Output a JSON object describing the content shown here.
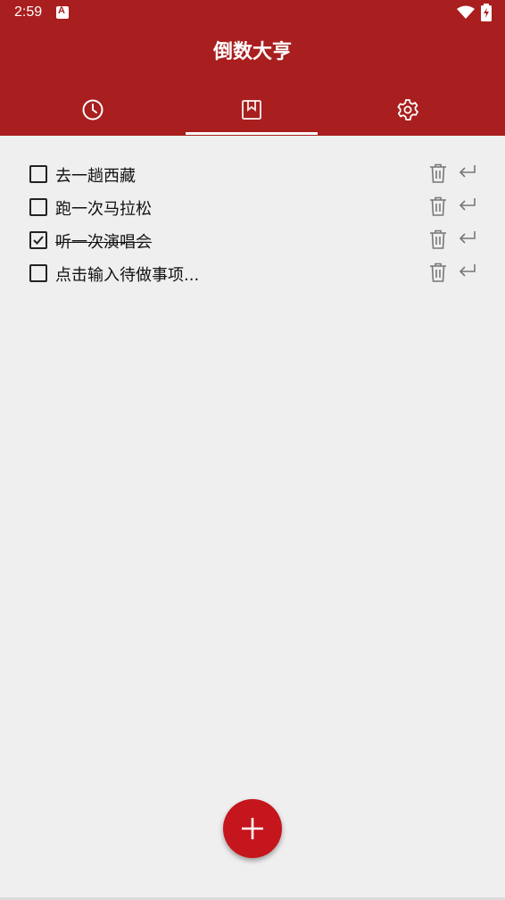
{
  "status": {
    "time": "2:59",
    "app_icon_letter": "A"
  },
  "app": {
    "title": "倒数大亨"
  },
  "tabs": [
    {
      "icon": "clock-icon"
    },
    {
      "icon": "bookmark-icon",
      "selected": true
    },
    {
      "icon": "gear-icon"
    }
  ],
  "todos": [
    {
      "text": "去一趟西藏",
      "checked": false
    },
    {
      "text": "跑一次马拉松",
      "checked": false
    },
    {
      "text": "听一次演唱会",
      "checked": true
    },
    {
      "text": "点击输入待做事项...",
      "checked": false
    }
  ],
  "colors": {
    "primary": "#a91e1e",
    "fab": "#c4161c",
    "background": "#efefef"
  }
}
